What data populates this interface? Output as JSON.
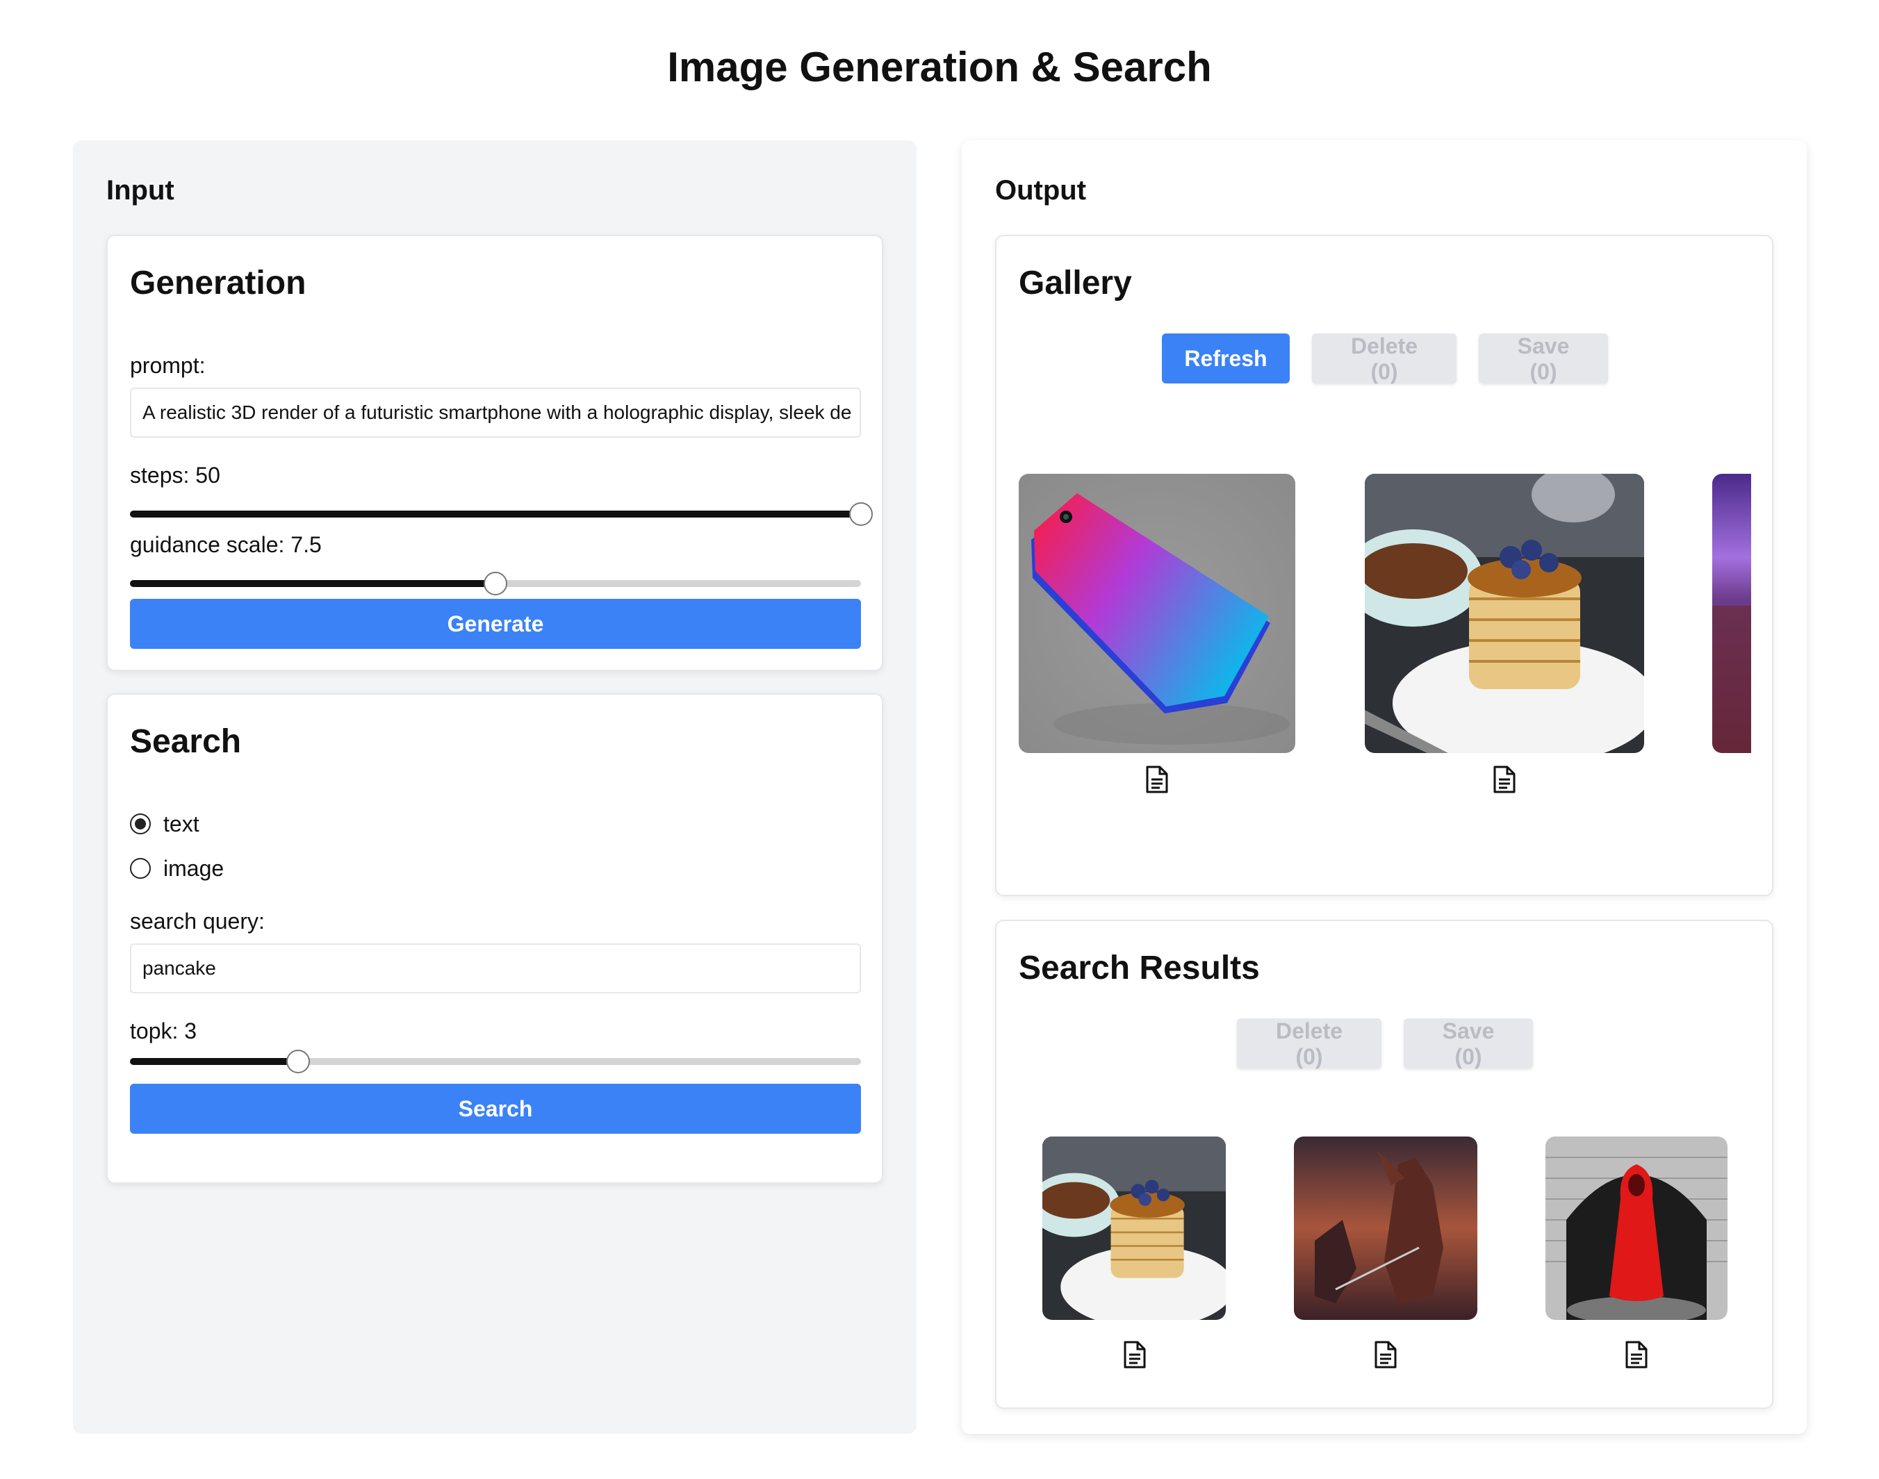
{
  "page": {
    "title": "Image Generation & Search"
  },
  "input": {
    "title": "Input",
    "generation": {
      "title": "Generation",
      "prompt_label": "prompt:",
      "prompt_value": "A realistic 3D render of a futuristic smartphone with a holographic display, sleek de",
      "steps_label": "steps: 50",
      "steps_value": 50,
      "steps_fill": 1.0,
      "guidance_label": "guidance scale: 7.5",
      "guidance_value": 7.5,
      "guidance_fill": 0.5,
      "generate_label": "Generate"
    },
    "search": {
      "title": "Search",
      "mode_options": [
        "text",
        "image"
      ],
      "mode_selected": "text",
      "query_label": "search query:",
      "query_value": "pancake",
      "topk_label": "topk: 3",
      "topk_value": 3,
      "topk_fill": 0.23,
      "search_label": "Search"
    }
  },
  "output": {
    "title": "Output",
    "gallery": {
      "title": "Gallery",
      "refresh_label": "Refresh",
      "delete_label": "Delete (0)",
      "save_label": "Save (0)",
      "images": [
        "smartphone-image",
        "pancakes-image",
        "purple-landscape-image"
      ]
    },
    "search_results": {
      "title": "Search Results",
      "delete_label": "Delete (0)",
      "save_label": "Save (0)",
      "images": [
        "pancakes-image",
        "dragon-warrior-image",
        "red-cloak-image"
      ]
    }
  },
  "colors": {
    "accent": "#3b82f6",
    "panel_bg": "#f3f4f6",
    "disabled_bg": "#e5e7eb",
    "disabled_text": "#b9bcc3"
  }
}
